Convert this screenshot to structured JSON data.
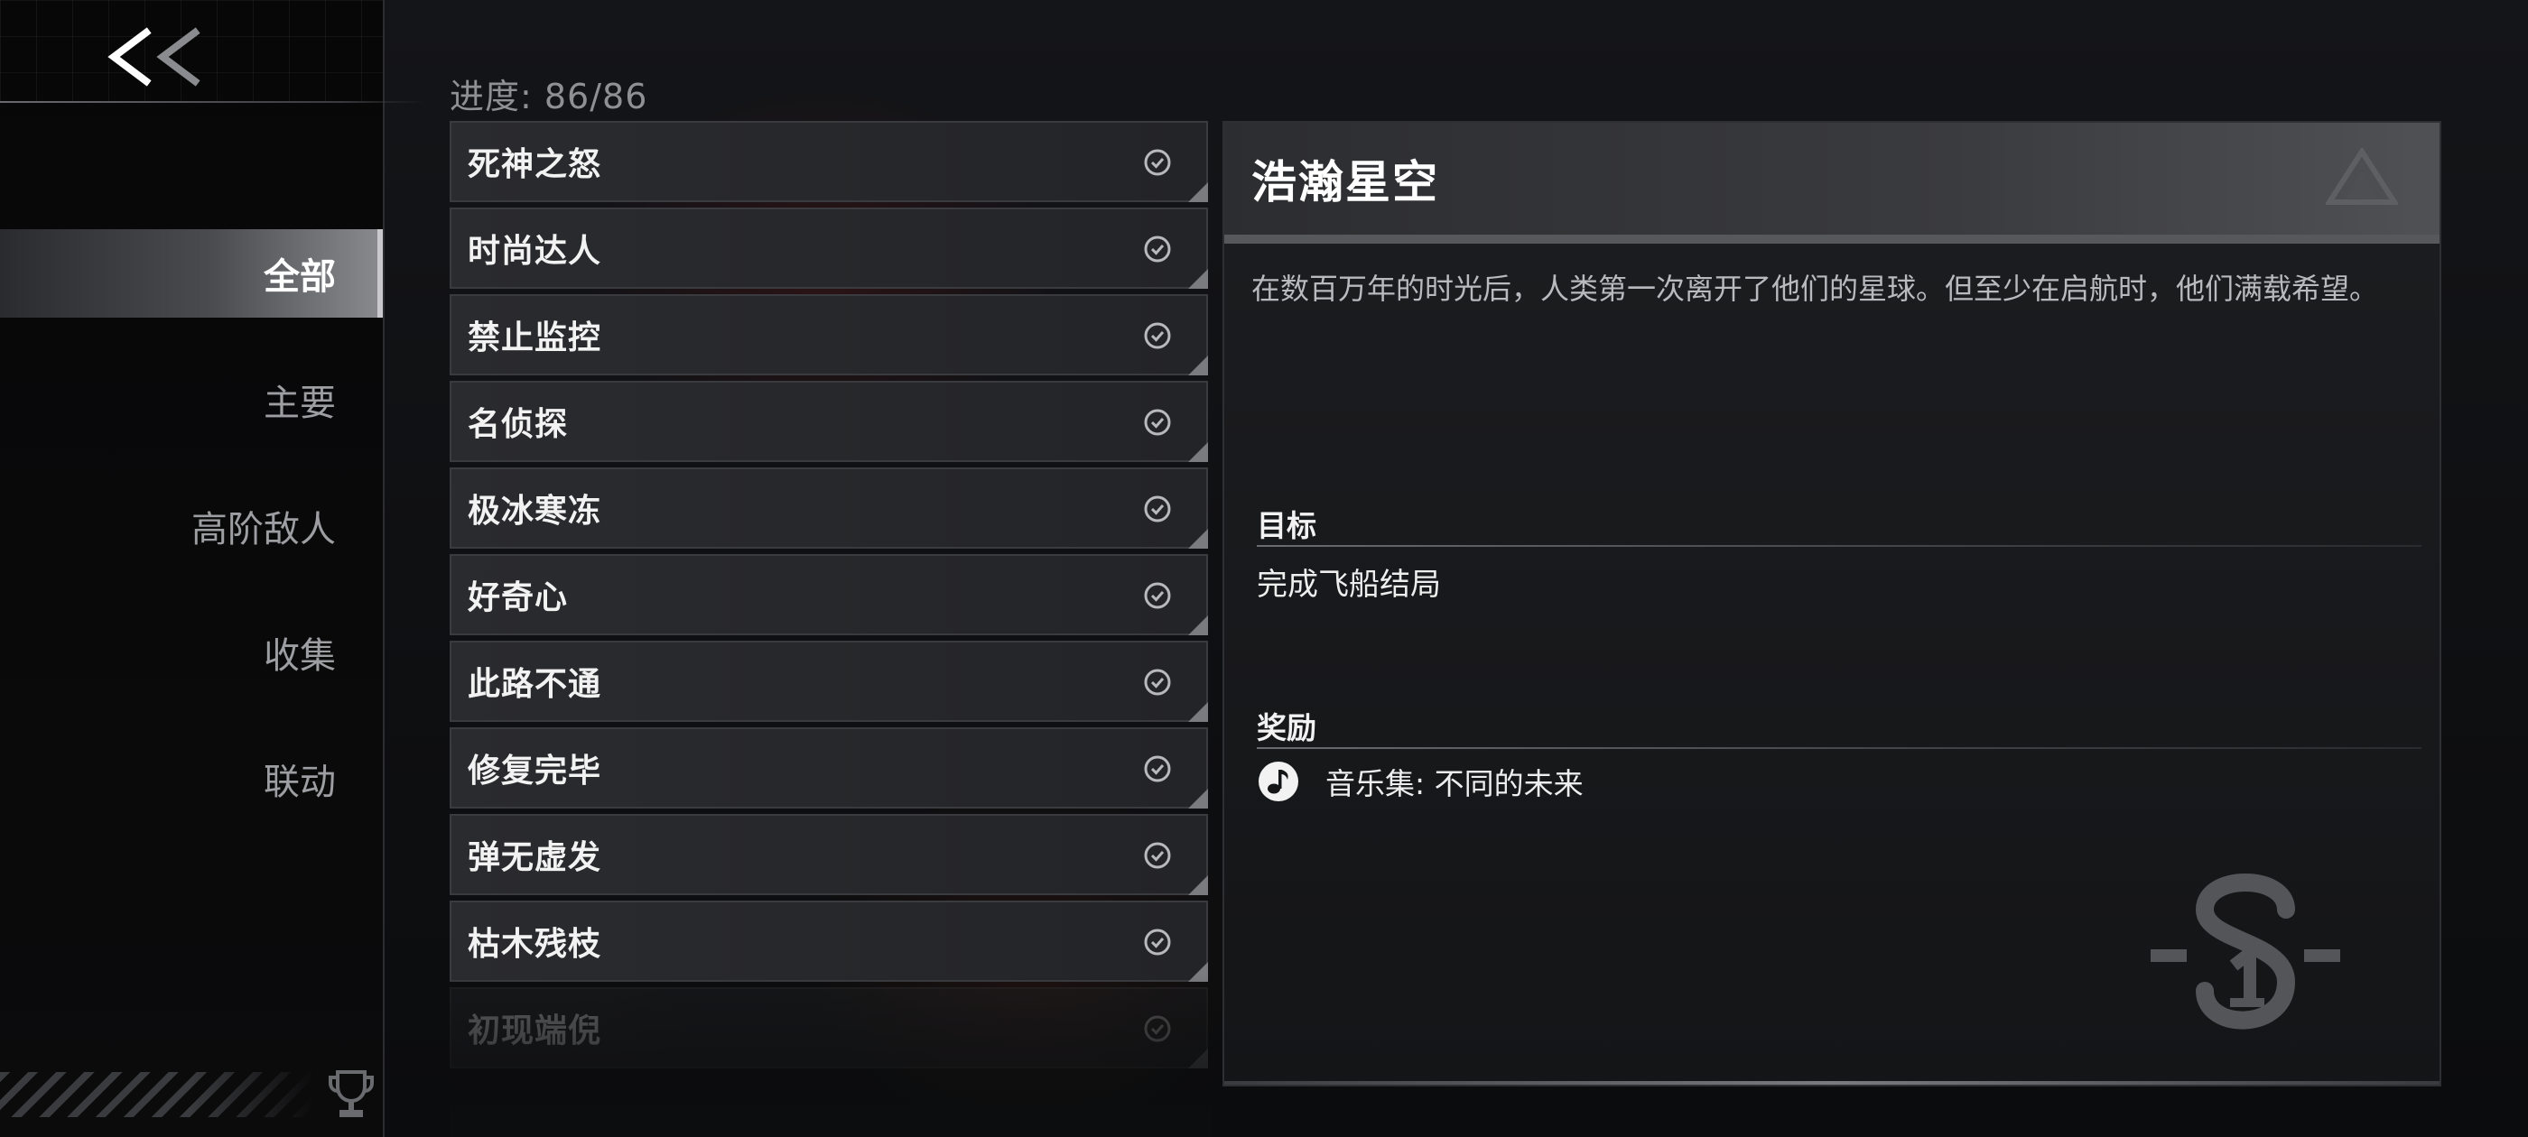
{
  "sidebar": {
    "back_label": "<<",
    "nav": [
      {
        "label": "全部",
        "active": true
      },
      {
        "label": "主要",
        "active": false
      },
      {
        "label": "高阶敌人",
        "active": false
      },
      {
        "label": "收集",
        "active": false
      },
      {
        "label": "联动",
        "active": false
      }
    ]
  },
  "progress": "进度: 86/86",
  "achievements": [
    {
      "name": "死神之怒",
      "completed": true
    },
    {
      "name": "时尚达人",
      "completed": true
    },
    {
      "name": "禁止监控",
      "completed": true
    },
    {
      "name": "名侦探",
      "completed": true
    },
    {
      "name": "极冰寒冻",
      "completed": true
    },
    {
      "name": "好奇心",
      "completed": true
    },
    {
      "name": "此路不通",
      "completed": true
    },
    {
      "name": "修复完毕",
      "completed": true
    },
    {
      "name": "弹无虚发",
      "completed": true
    },
    {
      "name": "枯木残枝",
      "completed": true
    },
    {
      "name": "初现端倪",
      "completed": true
    }
  ],
  "detail": {
    "title": "浩瀚星空",
    "description": "在数百万年的时光后，人类第一次离开了他们的星球。但至少在启航时，他们满载希望。",
    "goal_label": "目标",
    "goal_text": "完成飞船结局",
    "reward_label": "奖励",
    "reward_text": "音乐集: 不同的未来",
    "reward_icon": "music-note-icon"
  },
  "colors": {
    "background": "#0c0d0f",
    "active_tab": "#8a8b8f",
    "panel": "#1c1d20",
    "text": "#f2f2f2",
    "muted": "#9d9ea2"
  }
}
